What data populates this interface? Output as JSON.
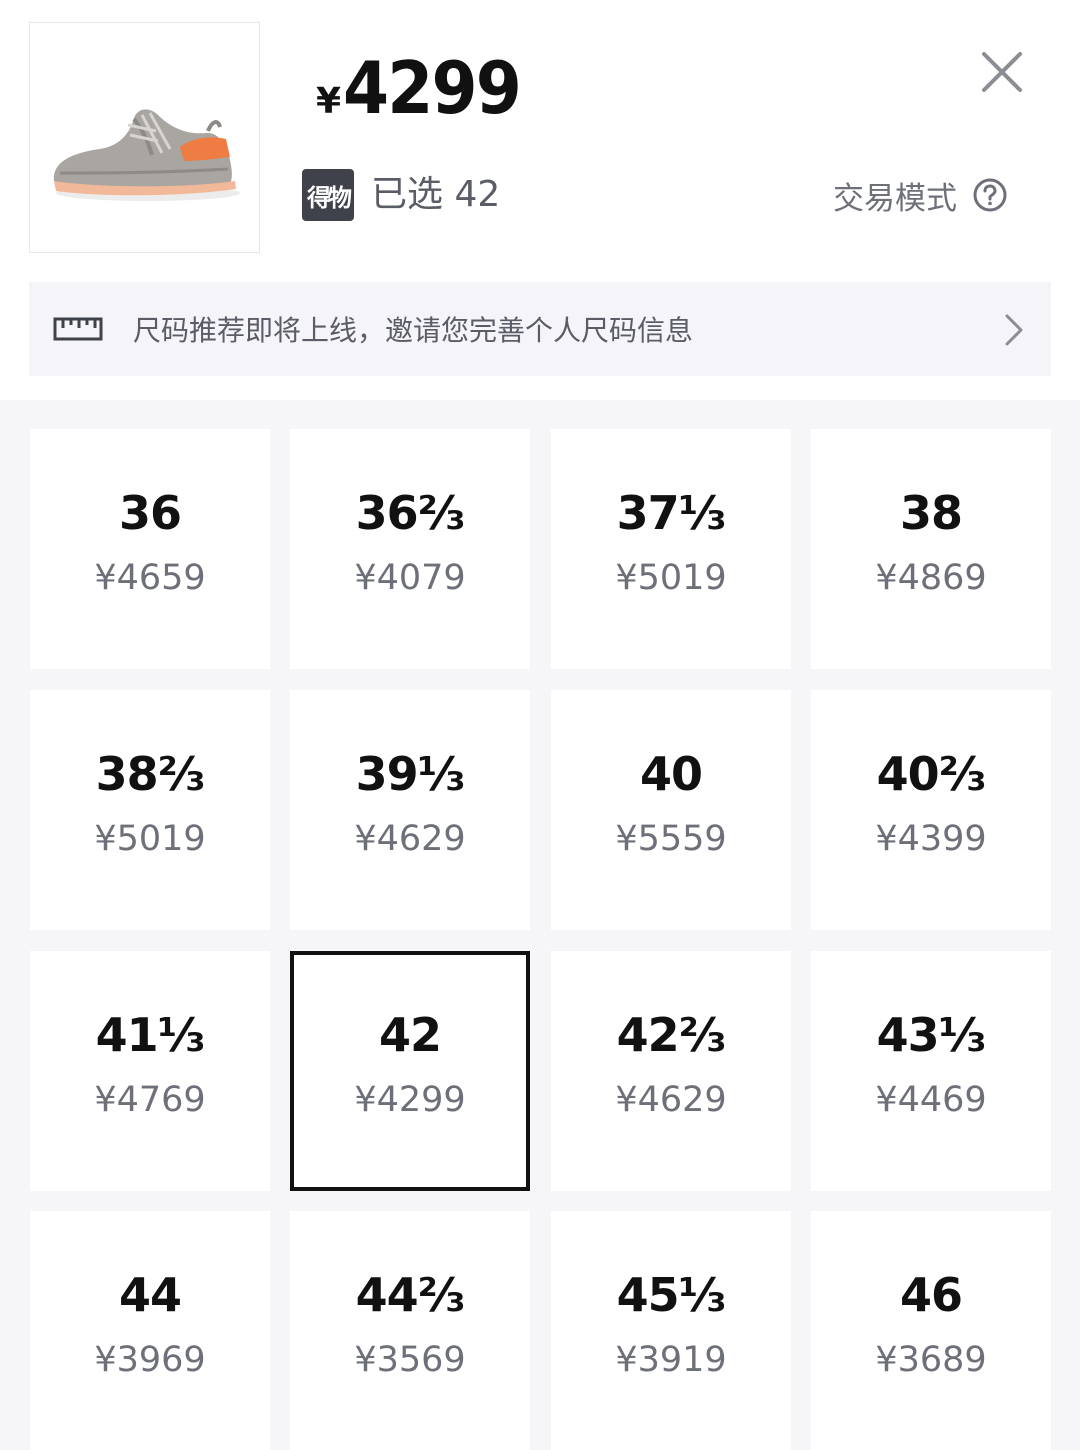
{
  "header": {
    "product_image": "shoe-product-image",
    "price_currency": "¥",
    "price_value": "4299",
    "close_icon": "close-icon",
    "brand_badge": "得物",
    "selected_text": "已选 42",
    "trade_mode_label": "交易模式",
    "help_icon": "help-circle-icon"
  },
  "size_banner": {
    "icon": "ruler-icon",
    "text": "尺码推荐即将上线，邀请您完善个人尺码信息",
    "chevron_icon": "chevron-right-icon"
  },
  "sizes": [
    {
      "size": "36",
      "price": "¥4659"
    },
    {
      "size": "36⅔",
      "price": "¥4079"
    },
    {
      "size": "37⅓",
      "price": "¥5019"
    },
    {
      "size": "38",
      "price": "¥4869"
    },
    {
      "size": "38⅔",
      "price": "¥5019"
    },
    {
      "size": "39⅓",
      "price": "¥4629"
    },
    {
      "size": "40",
      "price": "¥5559"
    },
    {
      "size": "40⅔",
      "price": "¥4399"
    },
    {
      "size": "41⅓",
      "price": "¥4769"
    },
    {
      "size": "42",
      "price": "¥4299",
      "selected": true
    },
    {
      "size": "42⅔",
      "price": "¥4629"
    },
    {
      "size": "43⅓",
      "price": "¥4469"
    },
    {
      "size": "44",
      "price": "¥3969"
    },
    {
      "size": "44⅔",
      "price": "¥3569"
    },
    {
      "size": "45⅓",
      "price": "¥3919"
    },
    {
      "size": "46",
      "price": "¥3689"
    }
  ],
  "colors": {
    "selected_border": "#111111",
    "grid_background": "#f6f6f9",
    "banner_background": "#f5f5f9",
    "badge_background": "#3f424a"
  }
}
